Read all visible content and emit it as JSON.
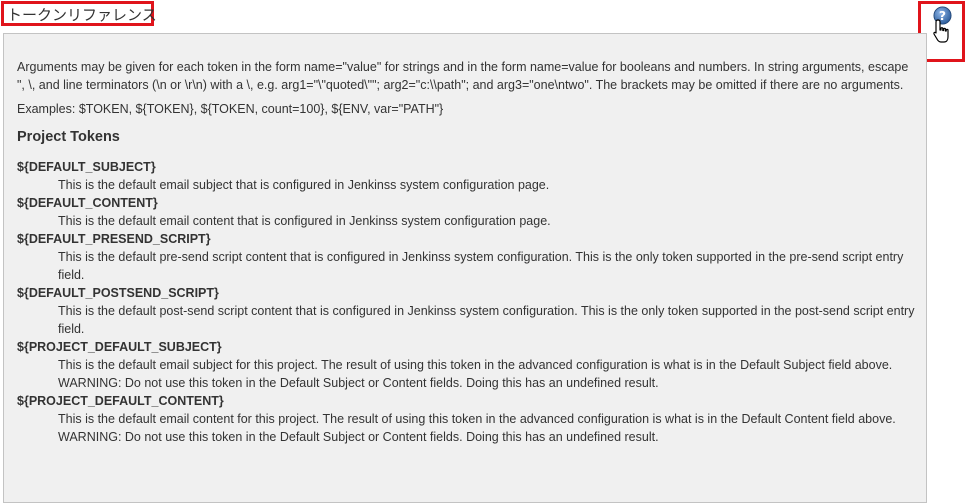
{
  "header": {
    "title": "トークンリファレンス",
    "help_icon": "question-circle-icon",
    "cursor_icon": "hand-pointer-icon",
    "highlight_color": "#e0141b"
  },
  "panel": {
    "intro": "Arguments may be given for each token in the form name=\"value\" for strings and in the form name=value for booleans and numbers. In string arguments, escape \", \\, and line terminators (\\n or \\r\\n) with a \\, e.g. arg1=\"\\\"quoted\\\"\"; arg2=\"c:\\\\path\"; and arg3=\"one\\ntwo\". The brackets may be omitted if there are no arguments.",
    "examples": "Examples: $TOKEN, ${TOKEN}, ${TOKEN, count=100}, ${ENV, var=\"PATH\"}",
    "section_title": "Project Tokens",
    "tokens": [
      {
        "name": "${DEFAULT_SUBJECT}",
        "description": "This is the default email subject that is configured in Jenkinss system configuration page."
      },
      {
        "name": "${DEFAULT_CONTENT}",
        "description": "This is the default email content that is configured in Jenkinss system configuration page."
      },
      {
        "name": "${DEFAULT_PRESEND_SCRIPT}",
        "description": "This is the default pre-send script content that is configured in Jenkinss system configuration. This is the only token supported in the pre-send script entry field."
      },
      {
        "name": "${DEFAULT_POSTSEND_SCRIPT}",
        "description": "This is the default post-send script content that is configured in Jenkinss system configuration. This is the only token supported in the post-send script entry field."
      },
      {
        "name": "${PROJECT_DEFAULT_SUBJECT}",
        "description": "This is the default email subject for this project. The result of using this token in the advanced configuration is what is in the Default Subject field above. WARNING: Do not use this token in the Default Subject or Content fields. Doing this has an undefined result."
      },
      {
        "name": "${PROJECT_DEFAULT_CONTENT}",
        "description": "This is the default email content for this project. The result of using this token in the advanced configuration is what is in the Default Content field above. WARNING: Do not use this token in the Default Subject or Content fields. Doing this has an undefined result."
      }
    ]
  }
}
